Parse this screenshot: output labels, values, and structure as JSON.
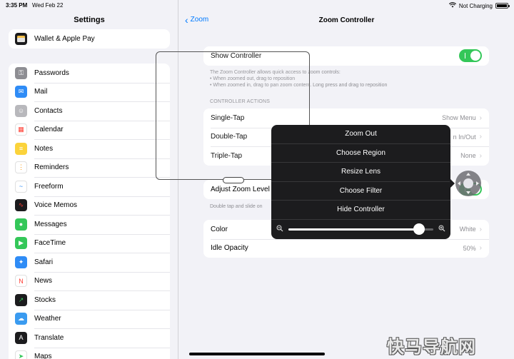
{
  "status_bar": {
    "time": "3:35 PM",
    "date": "Wed Feb 22",
    "wifi_icon": "wifi-icon",
    "charging_text": "Not Charging",
    "battery_level": 1.0
  },
  "sidebar": {
    "title": "Settings",
    "top_item": {
      "label": "Wallet & Apple Pay",
      "icon": "wallet-icon",
      "color": "#1c1c1e"
    },
    "items": [
      {
        "label": "Passwords",
        "icon": "key-icon",
        "color": "#8e8e93"
      },
      {
        "label": "Mail",
        "icon": "mail-icon",
        "color": "#2f8cf6"
      },
      {
        "label": "Contacts",
        "icon": "contacts-icon",
        "color": "#b8b8bc"
      },
      {
        "label": "Calendar",
        "icon": "calendar-icon",
        "color": "#ffffff"
      },
      {
        "label": "Notes",
        "icon": "notes-icon",
        "color": "#fbd33b"
      },
      {
        "label": "Reminders",
        "icon": "reminders-icon",
        "color": "#ffffff"
      },
      {
        "label": "Freeform",
        "icon": "freeform-icon",
        "color": "#ffffff"
      },
      {
        "label": "Voice Memos",
        "icon": "voice-memos-icon",
        "color": "#1c1c1e"
      },
      {
        "label": "Messages",
        "icon": "messages-icon",
        "color": "#34c759"
      },
      {
        "label": "FaceTime",
        "icon": "facetime-icon",
        "color": "#34c759"
      },
      {
        "label": "Safari",
        "icon": "safari-icon",
        "color": "#2f8cf6"
      },
      {
        "label": "News",
        "icon": "news-icon",
        "color": "#ffffff"
      },
      {
        "label": "Stocks",
        "icon": "stocks-icon",
        "color": "#1c1c1e"
      },
      {
        "label": "Weather",
        "icon": "weather-icon",
        "color": "#3a9bf0"
      },
      {
        "label": "Translate",
        "icon": "translate-icon",
        "color": "#1c1c1e"
      },
      {
        "label": "Maps",
        "icon": "maps-icon",
        "color": "#ffffff"
      }
    ]
  },
  "main": {
    "back_label": "Zoom",
    "title": "Zoom Controller",
    "show_controller_label": "Show Controller",
    "show_controller_on": true,
    "footnote_lines": [
      "The Zoom Controller allows quick access to zoom controls:",
      "• When zoomed out, drag to reposition",
      "• When zoomed in, drag to pan zoom content. Long press and drag to reposition"
    ],
    "actions_header": "CONTROLLER ACTIONS",
    "actions": [
      {
        "label": "Single-Tap",
        "value": "Show Menu"
      },
      {
        "label": "Double-Tap",
        "value": "n In/Out"
      },
      {
        "label": "Triple-Tap",
        "value": "None"
      }
    ],
    "adjust_zoom_label": "Adjust Zoom Level",
    "adjust_zoom_on": true,
    "adjust_footnote": "Double tap and slide on",
    "appearance": [
      {
        "label": "Color",
        "value": "White"
      },
      {
        "label": "Idle Opacity",
        "value": "50%"
      }
    ]
  },
  "zoom_menu": {
    "items": [
      "Zoom Out",
      "Choose Region",
      "Resize Lens",
      "Choose Filter",
      "Hide Controller"
    ],
    "zoom_min_icon": "zoom-out-icon",
    "zoom_max_icon": "zoom-in-icon",
    "zoom_level": 0.9
  },
  "colors": {
    "accent": "#007aff",
    "toggle_on": "#34c759",
    "menu_bg": "#1c1c1e"
  },
  "watermark": "快马导航网"
}
